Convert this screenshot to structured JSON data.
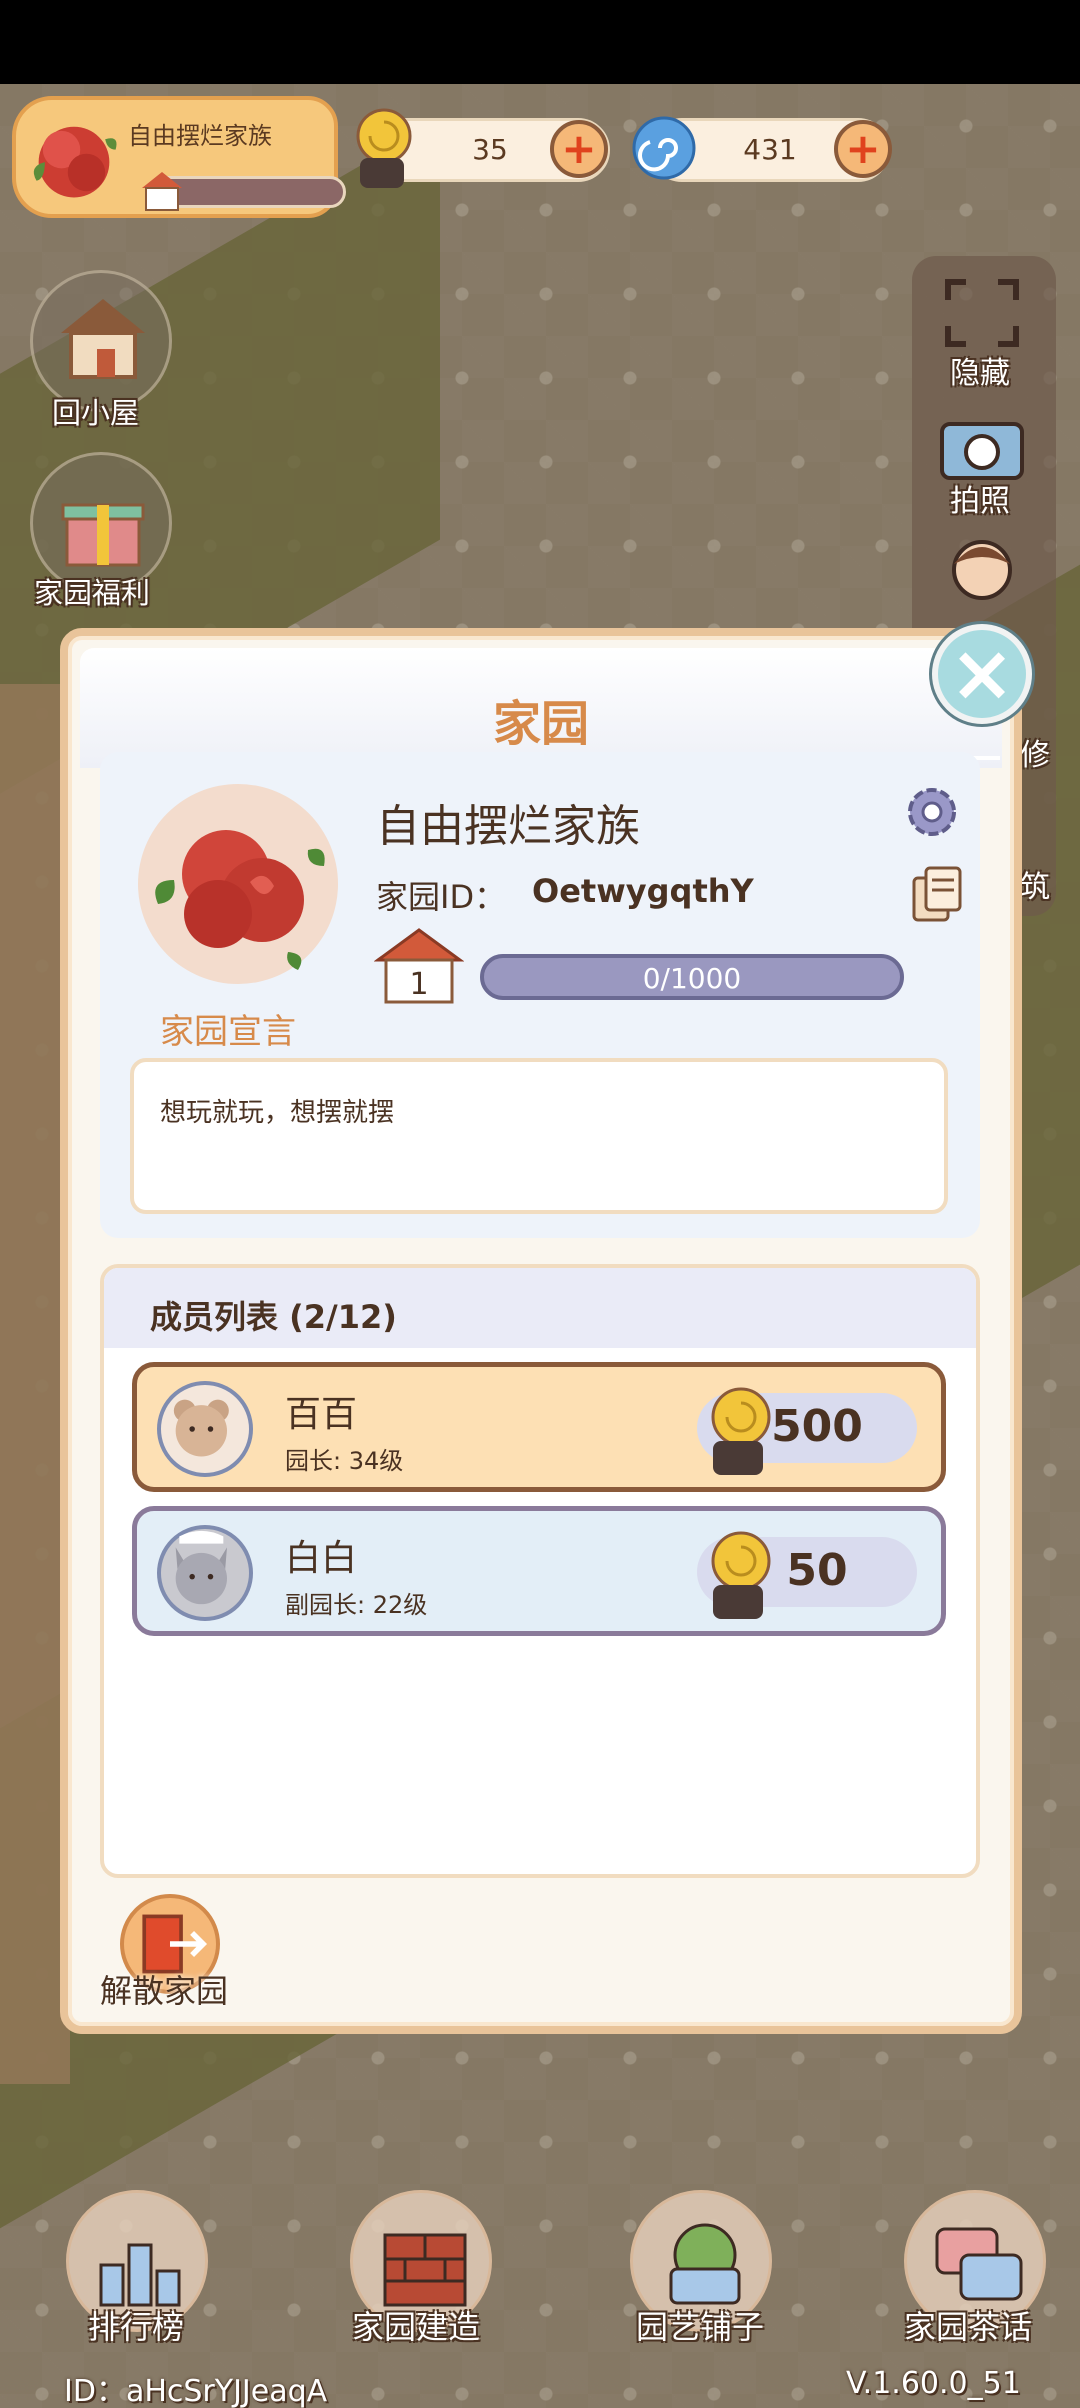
{
  "hud": {
    "family_name": "自由摆烂家族",
    "family_level": "1",
    "snail_coins": "35",
    "spiral_gems": "431"
  },
  "left_menu": {
    "home_label": "回小屋",
    "welfare_label": "家园福利"
  },
  "right_menu": {
    "hide_label": "隐藏",
    "photo_label": "拍照",
    "repair_label": "修",
    "build_label": "筑"
  },
  "dialog": {
    "title": "家园",
    "family_name": "自由摆烂家族",
    "id_label": "家园ID：",
    "id_value": "OetwygqthY",
    "level": "1",
    "exp_text": "0/1000",
    "exp_fraction": 0,
    "declaration_label": "家园宣言",
    "declaration_text": "想玩就玩，想摆就摆",
    "members_title": "成员列表 (2/12)",
    "members": [
      {
        "name": "百百",
        "role": "园长: 34级",
        "score": "500"
      },
      {
        "name": "白白",
        "role": "副园长: 22级",
        "score": "50"
      }
    ],
    "disband_label": "解散家园"
  },
  "bottom_nav": {
    "rank_label": "排行榜",
    "build_label": "家园建造",
    "shop_label": "园艺铺子",
    "chat_label": "家园茶话"
  },
  "footer": {
    "player_id": "ID：aHcSrYJJeaqA",
    "version": "V.1.60.0_51"
  },
  "colors": {
    "accent_orange": "#d78a4a",
    "dialog_border": "#e9c49a",
    "leader_row": "#fde0b4",
    "vice_row": "#e3eef7"
  }
}
